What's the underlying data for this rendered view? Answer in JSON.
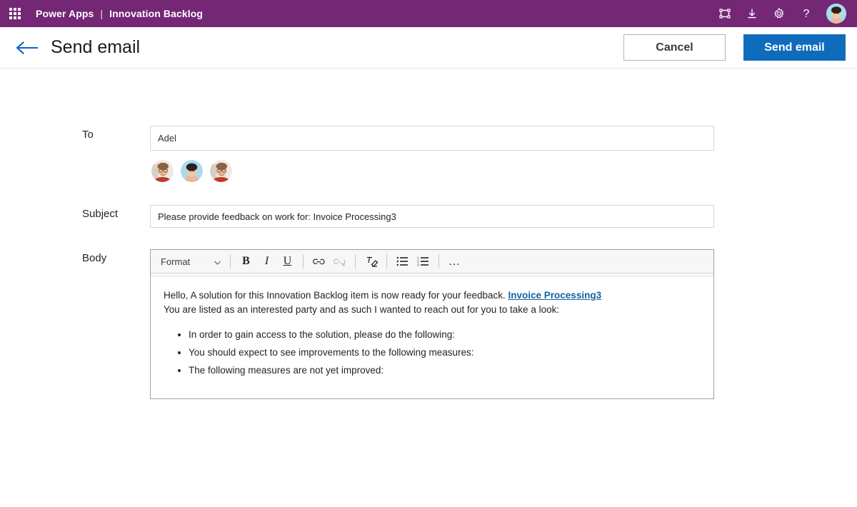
{
  "suite": {
    "waffle_icon": "waffle-grid-icon",
    "brand": "Power Apps",
    "separator": "|",
    "context": "Innovation Backlog",
    "actions": [
      {
        "icon": "resize-frame-icon",
        "label": "Resize"
      },
      {
        "icon": "download-icon",
        "label": "Download"
      },
      {
        "icon": "gear-icon",
        "label": "Settings"
      },
      {
        "icon": "question-mark-icon",
        "label": "Help"
      }
    ],
    "avatar": {
      "icon": "user-avatar",
      "label": "Account manager"
    }
  },
  "command_bar": {
    "back_icon": "back-arrow-icon",
    "title": "Send email",
    "cancel_label": "Cancel",
    "send_label": "Send email"
  },
  "form": {
    "to": {
      "label": "To",
      "value": "Adel",
      "placeholder": ""
    },
    "suggestions": [
      {
        "name": "suggestion-avatar-1"
      },
      {
        "name": "suggestion-avatar-2"
      },
      {
        "name": "suggestion-avatar-3"
      }
    ],
    "subject": {
      "label": "Subject",
      "value": "Please provide feedback on work for: Invoice Processing3",
      "placeholder": ""
    },
    "body": {
      "label": "Body",
      "toolbar": {
        "format_label": "Format",
        "chevron_icon": "chevron-down-icon",
        "bold": "B",
        "italic": "I",
        "underline": "U",
        "link_icon": "link-icon",
        "unlink_icon": "unlink-icon",
        "clear_format_icon": "clear-formatting-icon",
        "bullet_list_icon": "bullet-list-icon",
        "numbered_list_icon": "numbered-list-icon",
        "overflow_label": "…"
      },
      "paragraph_1_prefix": "Hello, A solution for this Innovation Backlog item is now ready for your feedback. ",
      "link_text": "Invoice Processing3",
      "paragraph_2": "You are listed as an interested party and as such I wanted to reach out for you to take a look:",
      "bullets": [
        "In order to gain access to the solution, please do the following:",
        "You should expect to see improvements to the following measures:",
        "The following measures are not yet improved:"
      ]
    }
  },
  "colors": {
    "suite_purple": "#742774",
    "accent_blue": "#0f6cbd",
    "link_blue": "#1264a3",
    "back_arrow_blue": "#0b63ce"
  }
}
